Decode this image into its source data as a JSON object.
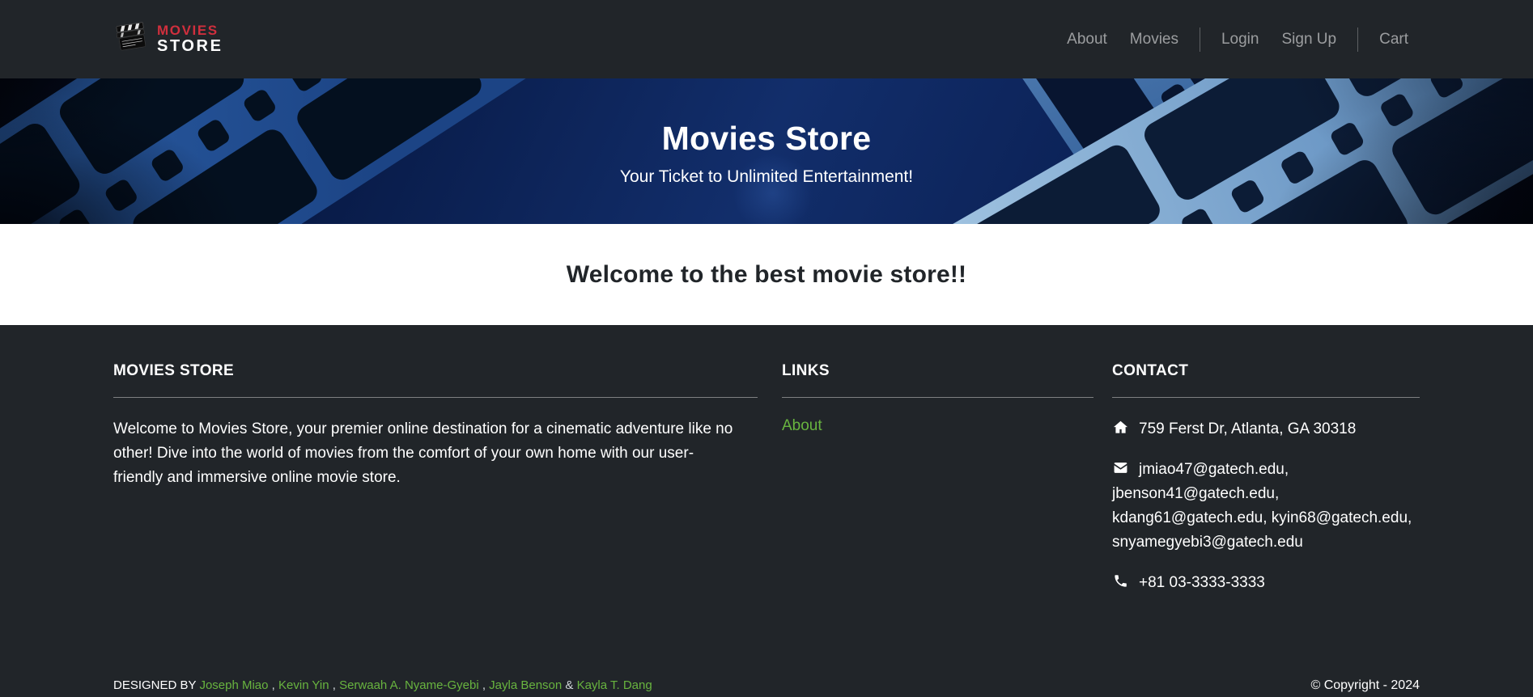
{
  "colors": {
    "accent_red": "#d02f3d",
    "link_green": "#68b43f",
    "dark_bg": "#212529",
    "hero_navy": "#122e6b"
  },
  "navbar": {
    "logo": {
      "line1": "MOVIES",
      "line2": "STORE"
    },
    "links": [
      {
        "label": "About"
      },
      {
        "label": "Movies"
      }
    ],
    "auth_links": [
      {
        "label": "Login"
      },
      {
        "label": "Sign Up"
      }
    ],
    "cart_label": "Cart"
  },
  "hero": {
    "title": "Movies Store",
    "subtitle": "Your Ticket to Unlimited Entertainment!"
  },
  "main": {
    "welcome_heading": "Welcome to the best movie store!!"
  },
  "footer": {
    "about": {
      "heading": "MOVIES STORE",
      "text": "Welcome to Movies Store, your premier online destination for a cinematic adventure like no other! Dive into the world of movies from the comfort of your own home with our user-friendly and immersive online movie store."
    },
    "links": {
      "heading": "LINKS",
      "items": [
        {
          "label": "About"
        }
      ]
    },
    "contact": {
      "heading": "CONTACT",
      "address": "759 Ferst Dr, Atlanta, GA 30318",
      "emails": "jmiao47@gatech.edu, jbenson41@gatech.edu, kdang61@gatech.edu, kyin68@gatech.edu, snyamegyebi3@gatech.edu",
      "phone": "+81 03-3333-3333"
    },
    "designed_by": {
      "prefix": "DESIGNED BY",
      "names": [
        "Joseph Miao",
        "Kevin Yin",
        "Serwaah A. Nyame-Gyebi",
        "Jayla Benson",
        "Kayla T. Dang"
      ],
      "separator": ",",
      "last_separator": "&"
    },
    "copyright": "© Copyright - 2024"
  }
}
